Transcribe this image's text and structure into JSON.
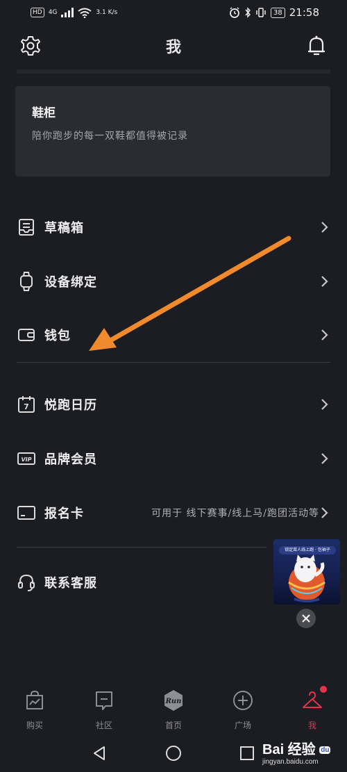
{
  "status_bar": {
    "hd": "HD",
    "signal": "4G",
    "speed": "3.1 K/s",
    "battery": "38",
    "time": "21:58"
  },
  "header": {
    "title": "我",
    "left_icon": "gear-icon",
    "right_icon": "bell-icon"
  },
  "shoe_card": {
    "title": "鞋柜",
    "subtitle": "陪你跑步的每一双鞋都值得被记录"
  },
  "menu": {
    "group1": [
      {
        "label": "草稿箱",
        "icon": "drafts-icon"
      },
      {
        "label": "设备绑定",
        "icon": "watch-icon"
      },
      {
        "label": "钱包",
        "icon": "wallet-icon"
      }
    ],
    "group2": [
      {
        "label": "悦跑日历",
        "icon": "calendar-icon",
        "calendar_number": "7"
      },
      {
        "label": "品牌会员",
        "icon": "vip-icon",
        "vip_text": "VIP"
      },
      {
        "label": "报名卡",
        "icon": "card-icon",
        "hint": "可用于 线下赛事/线上马/跑团活动等"
      }
    ],
    "group3": [
      {
        "label": "联系客服",
        "icon": "headset-icon"
      }
    ]
  },
  "promo": {
    "banner": "锁定菜人线上跑 · 包袖子"
  },
  "tabbar": [
    {
      "label": "购买",
      "icon": "shopping-bag-icon",
      "active": false
    },
    {
      "label": "社区",
      "icon": "community-icon",
      "active": false
    },
    {
      "label": "首页",
      "icon": "run-logo-icon",
      "logo_text": "Run",
      "active": false
    },
    {
      "label": "广场",
      "icon": "plus-circle-icon",
      "active": false
    },
    {
      "label": "我",
      "icon": "hanger-icon",
      "active": true
    }
  ],
  "watermark": {
    "main": "Bai 经验",
    "paw": "du",
    "sub": "jingyan.baidu.com"
  },
  "colors": {
    "background": "#1c1d22",
    "card": "#2b2c32",
    "accent": "#e6324b",
    "arrow": "#f08a2c"
  }
}
